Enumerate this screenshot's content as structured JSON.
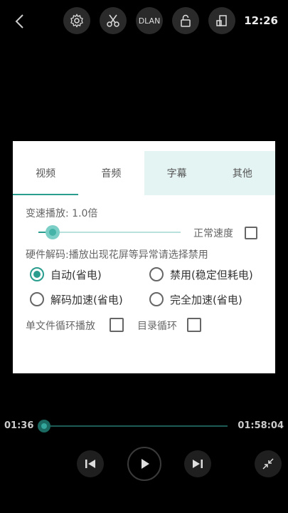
{
  "topbar": {
    "dlan_label": "DLAN",
    "clock": "12:26",
    "icons": [
      "back-icon",
      "gear-icon",
      "scissors-icon",
      "dlan-icon",
      "lock-icon",
      "rotate-icon"
    ]
  },
  "dialog": {
    "tabs": [
      {
        "label": "视频",
        "active": true
      },
      {
        "label": "音频",
        "active": false
      },
      {
        "label": "字幕",
        "active": false
      },
      {
        "label": "其他",
        "active": false
      }
    ],
    "speed_label": "变速播放: 1.0倍",
    "speed_value": 0.1,
    "normal_speed_label": "正常速度",
    "normal_speed_checked": false,
    "hw_decode_label": "硬件解码:播放出现花屏等异常请选择禁用",
    "options": [
      {
        "label": "自动(省电)",
        "checked": true
      },
      {
        "label": "禁用(稳定但耗电)",
        "checked": false
      },
      {
        "label": "解码加速(省电)",
        "checked": false
      },
      {
        "label": "完全加速(省电)",
        "checked": false
      }
    ],
    "single_loop_label": "单文件循环播放",
    "single_loop_checked": false,
    "dir_loop_label": "目录循环",
    "dir_loop_checked": false
  },
  "player": {
    "elapsed": "01:36",
    "total": "01:58:04",
    "progress": 0.0
  },
  "colors": {
    "accent": "#2a9d8f",
    "tab_inactive_bg": "#e4f4f3",
    "background": "#000000"
  }
}
